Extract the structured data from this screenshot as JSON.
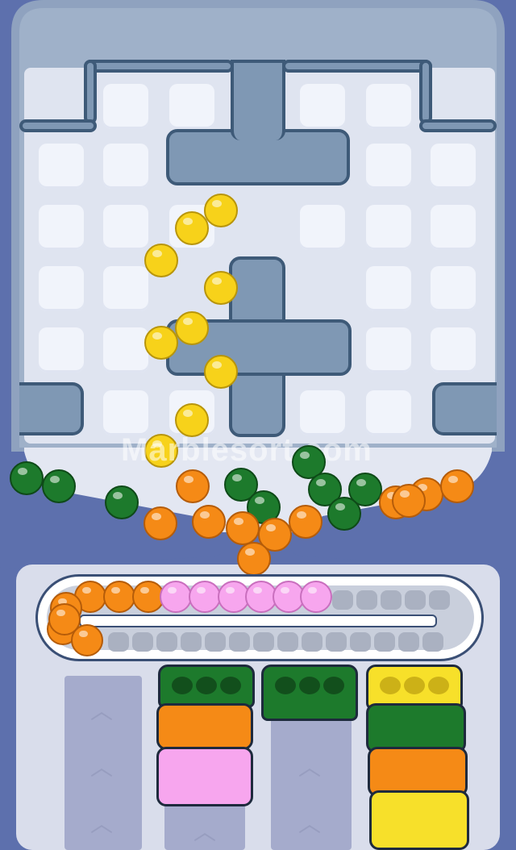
{
  "watermark": "Marblesort.com",
  "colors": {
    "frame": "#5d70ad",
    "board": "#dfe4f0",
    "wall": "#7f98b4",
    "tray": "#ffffff",
    "yellow": "#f7d21a",
    "orange": "#f58a16",
    "green": "#1d7a2c",
    "pink": "#f7a6ee"
  },
  "marbles_falling": [
    "yellow",
    "yellow",
    "yellow",
    "yellow",
    "yellow",
    "yellow",
    "yellow",
    "yellow",
    "yellow"
  ],
  "marbles_pile": [
    "green",
    "green",
    "orange",
    "green",
    "green",
    "green",
    "green",
    "green",
    "green",
    "green",
    "orange",
    "orange",
    "orange",
    "orange",
    "orange",
    "orange",
    "orange",
    "orange",
    "orange",
    "orange"
  ],
  "tray_marbles": [
    "orange",
    "orange",
    "orange",
    "orange",
    "orange",
    "pink",
    "pink",
    "pink",
    "pink",
    "pink",
    "pink",
    "orange",
    "orange"
  ],
  "containers": [
    {
      "name": "empty-lane",
      "blocks": []
    },
    {
      "name": "column-2",
      "blocks": [
        "green",
        "orange",
        "pink"
      ]
    },
    {
      "name": "column-3",
      "blocks": [
        "green"
      ]
    },
    {
      "name": "column-4",
      "blocks": [
        "yellow",
        "green",
        "orange",
        "yellow"
      ]
    }
  ],
  "icons": [
    "chevron-up-icon"
  ]
}
